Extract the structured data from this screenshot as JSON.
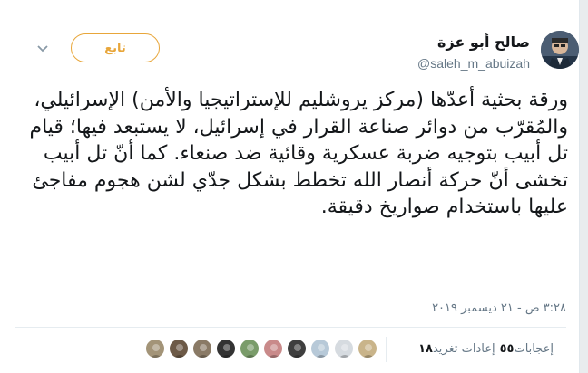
{
  "tweet": {
    "author_name": "صالح أبو عزة",
    "author_handle": "@saleh_m_abuizah",
    "follow_label": "تابع",
    "text": "ورقة بحثية أعدّها (مركز يروشليم للإستراتيجيا والأمن) الإسرائيلي، والمُقرّب من دوائر صناعة القرار في إسرائيل، لا يستبعد فيها؛ قيام تل أبيب بتوجيه ضربة عسكرية وقائية ضد صنعاء. كما أنّ تل أبيب تخشى أنّ حركة أنصار الله تخطط بشكل جدّي لشن هجوم مفاجئ عليها باستخدام صواريخ دقيقة.",
    "timestamp": "٣:٢٨ ص - ٢١ ديسمبر ٢٠١٩"
  },
  "stats": {
    "retweets_count": "١٨",
    "retweets_label": "إعادات تغريد",
    "likes_count": "٥٥",
    "likes_label": "إعجابات"
  },
  "likers": [
    {
      "icon": "liker-avatar-1",
      "color": "#c9b48a"
    },
    {
      "icon": "liker-avatar-2",
      "color": "#d6dbe0"
    },
    {
      "icon": "liker-avatar-3",
      "color": "#b7c9d8"
    },
    {
      "icon": "liker-avatar-4",
      "color": "#3f3f3f"
    },
    {
      "icon": "liker-avatar-5",
      "color": "#c98a8a"
    },
    {
      "icon": "liker-avatar-6",
      "color": "#7a9c6a"
    },
    {
      "icon": "liker-avatar-7",
      "color": "#333333"
    },
    {
      "icon": "liker-avatar-8",
      "color": "#8a7a66"
    },
    {
      "icon": "liker-avatar-9",
      "color": "#6d5a47"
    },
    {
      "icon": "liker-avatar-10",
      "color": "#a39478"
    }
  ],
  "colors": {
    "accent": "#e8a63a",
    "text": "#14171a",
    "secondary": "#657786"
  }
}
